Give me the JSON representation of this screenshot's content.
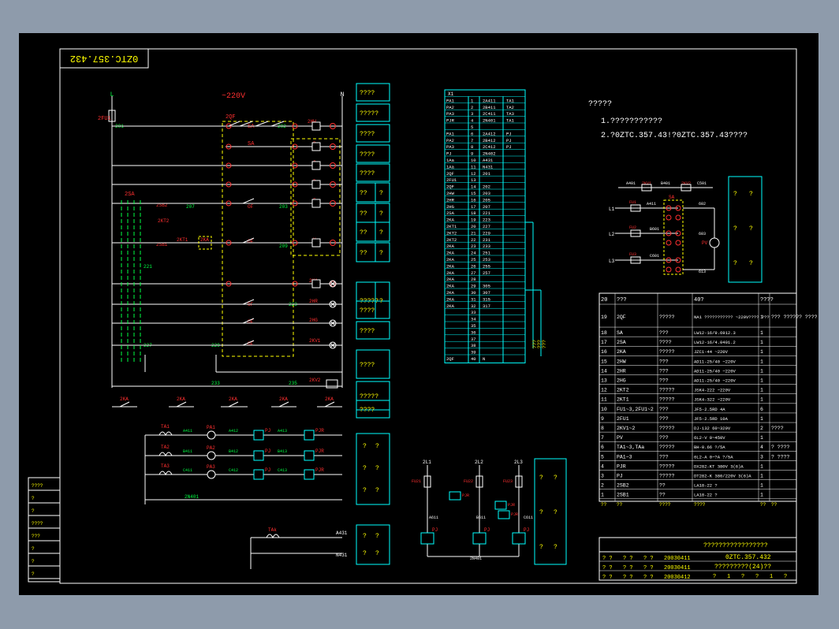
{
  "drawing_no_mirrored": "0ZTC.357.432",
  "voltage": "~220V",
  "bus": {
    "left": "L",
    "right": "N"
  },
  "notes": {
    "title": "?????",
    "line1": "1.???????????",
    "line2": "2.?0ZTC.357.43!?0ZTC.357.43????"
  },
  "left_desc": [
    "????",
    "?????",
    "????",
    "????",
    "????",
    "??",
    "??",
    "??",
    "??",
    "?????",
    "????",
    "????",
    "????",
    "?????",
    "????"
  ],
  "left_desc_aux": [
    "?",
    "?",
    "?",
    "?",
    "?"
  ],
  "labels": {
    "fu": "2FU1",
    "node201": "201",
    "q": "2QF",
    "sa": "SA",
    "sa2": "SA",
    "hw": "2HW",
    "lamp_b": "B",
    "lamp_c": "C",
    "lamp_d": "D",
    "lamp_f": "F",
    "lamp_y": "Y",
    "sa_top": "2SA",
    "sb2": "2SB2",
    "sb1": "2SB1",
    "kt2": "2KT2",
    "kt1": "2KT1",
    "ka": "2KA",
    "of": "OF",
    "n202": "202",
    "n203": "203",
    "n207": "207",
    "n209": "209",
    "hr": "2HR",
    "hg": "2HG",
    "ka2": "2KA",
    "kv1": "2KV1",
    "kv2": "2KV2",
    "n221": "221",
    "n223": "223",
    "n227": "227",
    "n229": "229",
    "n233": "233",
    "n235": "235"
  },
  "bottom_contacts": [
    "2KA",
    "2KA",
    "2KA",
    "2KA",
    "2KA"
  ],
  "meters": {
    "ta": [
      "TA1",
      "TA2",
      "TA3"
    ],
    "pa": [
      "PA1",
      "PA2",
      "PA3"
    ],
    "pj": [
      "PJ",
      "PJ",
      "PJ"
    ],
    "pjr": [
      "PJR",
      "PJR",
      "PJR"
    ],
    "n_in": [
      "A411",
      "B411",
      "C411"
    ],
    "n_mid": [
      "A412",
      "B412",
      "C412"
    ],
    "n_out": [
      "A413",
      "B413",
      "C413"
    ],
    "neutral": "2N401"
  },
  "ta_small": {
    "label": "TAk",
    "a": "A431",
    "n": "N431"
  },
  "terminal": {
    "header": "X1",
    "rows": [
      [
        "PA1",
        "1",
        "2A411",
        "TA1"
      ],
      [
        "PA2",
        "2",
        "2B411",
        "TA2"
      ],
      [
        "PA3",
        "3",
        "2C411",
        "TA3"
      ],
      [
        "PJR",
        "4",
        "2N401",
        "TA1"
      ],
      [
        "",
        "5",
        "",
        ""
      ],
      [
        "PA1",
        "6",
        "2A412",
        "PJ"
      ],
      [
        "PA2",
        "7",
        "2B412",
        "PJ"
      ],
      [
        "PA3",
        "8",
        "2C412",
        "PJ"
      ],
      [
        "PJ",
        "9",
        "2N402",
        ""
      ],
      [
        "1Aa",
        "10",
        "A431",
        ""
      ],
      [
        "1Aa",
        "11",
        "N431",
        ""
      ],
      [
        "2QF",
        "12",
        "201",
        ""
      ],
      [
        "2FU1",
        "13",
        "",
        ""
      ],
      [
        "2QF",
        "14",
        "202",
        ""
      ],
      [
        "2HW",
        "15",
        "203",
        ""
      ],
      [
        "2HR",
        "16",
        "205",
        ""
      ],
      [
        "2HG",
        "17",
        "207",
        ""
      ],
      [
        "2SA",
        "18",
        "221",
        ""
      ],
      [
        "2KA",
        "19",
        "223",
        ""
      ],
      [
        "2KT1",
        "20",
        "227",
        ""
      ],
      [
        "2KT2",
        "21",
        "229",
        ""
      ],
      [
        "2KT2",
        "22",
        "231",
        ""
      ],
      [
        "2KA",
        "23",
        "233",
        ""
      ],
      [
        "2KA",
        "24",
        "251",
        ""
      ],
      [
        "2KA",
        "25",
        "253",
        ""
      ],
      [
        "2KA",
        "26",
        "255",
        ""
      ],
      [
        "2KA",
        "27",
        "257",
        ""
      ],
      [
        "2KA",
        "28",
        "",
        ""
      ],
      [
        "2KA",
        "29",
        "305",
        ""
      ],
      [
        "2KA",
        "30",
        "307",
        ""
      ],
      [
        "2KA",
        "31",
        "315",
        ""
      ],
      [
        "2KA",
        "32",
        "317",
        ""
      ],
      [
        "",
        "33",
        "",
        ""
      ],
      [
        "",
        "34",
        "",
        ""
      ],
      [
        "",
        "35",
        "",
        ""
      ],
      [
        "",
        "36",
        "",
        ""
      ],
      [
        "",
        "37",
        "",
        ""
      ],
      [
        "",
        "38",
        "",
        ""
      ],
      [
        "",
        "39",
        "",
        ""
      ],
      [
        "2QF",
        "40",
        "N",
        ""
      ]
    ]
  },
  "bom": {
    "col_headers": [
      "20",
      "???",
      "",
      "40?",
      "????"
    ],
    "rows": [
      [
        "19",
        "2QF",
        "?????",
        "NA1 ??????????? ~220V???? ???",
        "1",
        "??? ?????? ????"
      ],
      [
        "18",
        "SA",
        "???",
        "LW12-16/9.6912.3",
        "1",
        ""
      ],
      [
        "17",
        "2SA",
        "????",
        "LW12-16/4.0401.2",
        "1",
        ""
      ],
      [
        "16",
        "2KA",
        "?????",
        "JZC1-44 ~220V",
        "1",
        ""
      ],
      [
        "15",
        "2HW",
        "???",
        "AD11-25/40 ~220V",
        "1",
        ""
      ],
      [
        "14",
        "2HR",
        "???",
        "AD11-25/40 ~220V",
        "1",
        ""
      ],
      [
        "13",
        "2HG",
        "???",
        "AD11-25/40 ~220V",
        "1",
        ""
      ],
      [
        "12",
        "2KT2",
        "?????",
        "JSK4-222 ~220V",
        "1",
        ""
      ],
      [
        "11",
        "2KT1",
        "?????",
        "JSK4-322 ~220V",
        "1",
        ""
      ],
      [
        "10",
        "FU1~3,2FU1~2",
        "???",
        "JF5-2.5RD 4A",
        "6",
        ""
      ],
      [
        "9",
        "2FU1",
        "???",
        "JF5-2.5RD 10A",
        "1",
        ""
      ],
      [
        "8",
        "2KV1~2",
        "?????",
        "DJ-132 60~320V",
        "2",
        "????"
      ],
      [
        "7",
        "PV",
        "???",
        "6L2-V 0~450V",
        "1",
        ""
      ],
      [
        "6",
        "TA1~3,TAa",
        "?????",
        "BH-0.66 ?/5A",
        "4",
        "? ????"
      ],
      [
        "5",
        "PA1~3",
        "???",
        "6L2-A 0~?A ?/5A",
        "3",
        "? ????"
      ],
      [
        "4",
        "PJR",
        "?????",
        "DX282-KT 380V 3(6)A",
        "1",
        ""
      ],
      [
        "3",
        "PJ",
        "?????",
        "DT282-K 380/220V 3(6)A",
        "1",
        ""
      ],
      [
        "2",
        "2SB2",
        "??",
        "LA18-22 ?",
        "1",
        ""
      ],
      [
        "1",
        "2SB1",
        "??",
        "LA18-22 ?",
        "1",
        ""
      ]
    ],
    "footer": [
      "??",
      "??",
      "????",
      "????",
      "??",
      "??"
    ]
  },
  "title_block": {
    "big_title": "?????????????????",
    "drawing_no": "0ZTC.357.432",
    "name": "?????????(24)??",
    "rows": [
      [
        "? ?",
        "? ?",
        "? ?",
        "20030411"
      ],
      [
        "? ?",
        "? ?",
        "? ?",
        "20030411"
      ],
      [
        "? ?",
        "? ?",
        "? ?",
        "20030412"
      ]
    ],
    "sheet_info": [
      "?",
      "1",
      "?",
      "?",
      "1",
      "?"
    ]
  },
  "left_strip": [
    "????",
    "?",
    "?",
    "????",
    "???",
    "?",
    "?",
    "?"
  ],
  "vt_circuit": {
    "labels": [
      "A401",
      "2KV1",
      "B401",
      "2KV2",
      "C501"
    ],
    "phases": [
      "L1",
      "L2",
      "L3"
    ],
    "fu": [
      "FU1",
      "FU2",
      "FU3"
    ],
    "sa": "SA",
    "pv": "PV",
    "n": [
      "A411",
      "B601",
      "C601",
      "602",
      "603",
      "613"
    ]
  },
  "side_boxes": {
    "vt": [
      "?",
      "?",
      "?",
      "?",
      "?",
      "?"
    ],
    "meter": [
      "?",
      "?",
      "?",
      "?",
      "?",
      "?"
    ],
    "pj_box": [
      "?",
      "?",
      "?",
      "?",
      "?",
      "?"
    ],
    "ta_box": [
      "?",
      "?",
      "?",
      "?"
    ]
  },
  "pj_circuit": {
    "phases": [
      "2L1",
      "2L2",
      "2L3"
    ],
    "fu": [
      "FU21",
      "FU22",
      "FU23"
    ],
    "pjr": [
      "PJR",
      "PJR",
      "PJR"
    ],
    "pj": [
      "PJ",
      "PJ",
      "PJ"
    ],
    "n": [
      "A611",
      "B611",
      "C611",
      "2N401"
    ]
  },
  "vertical_marks": [
    "???",
    "???",
    "???"
  ]
}
